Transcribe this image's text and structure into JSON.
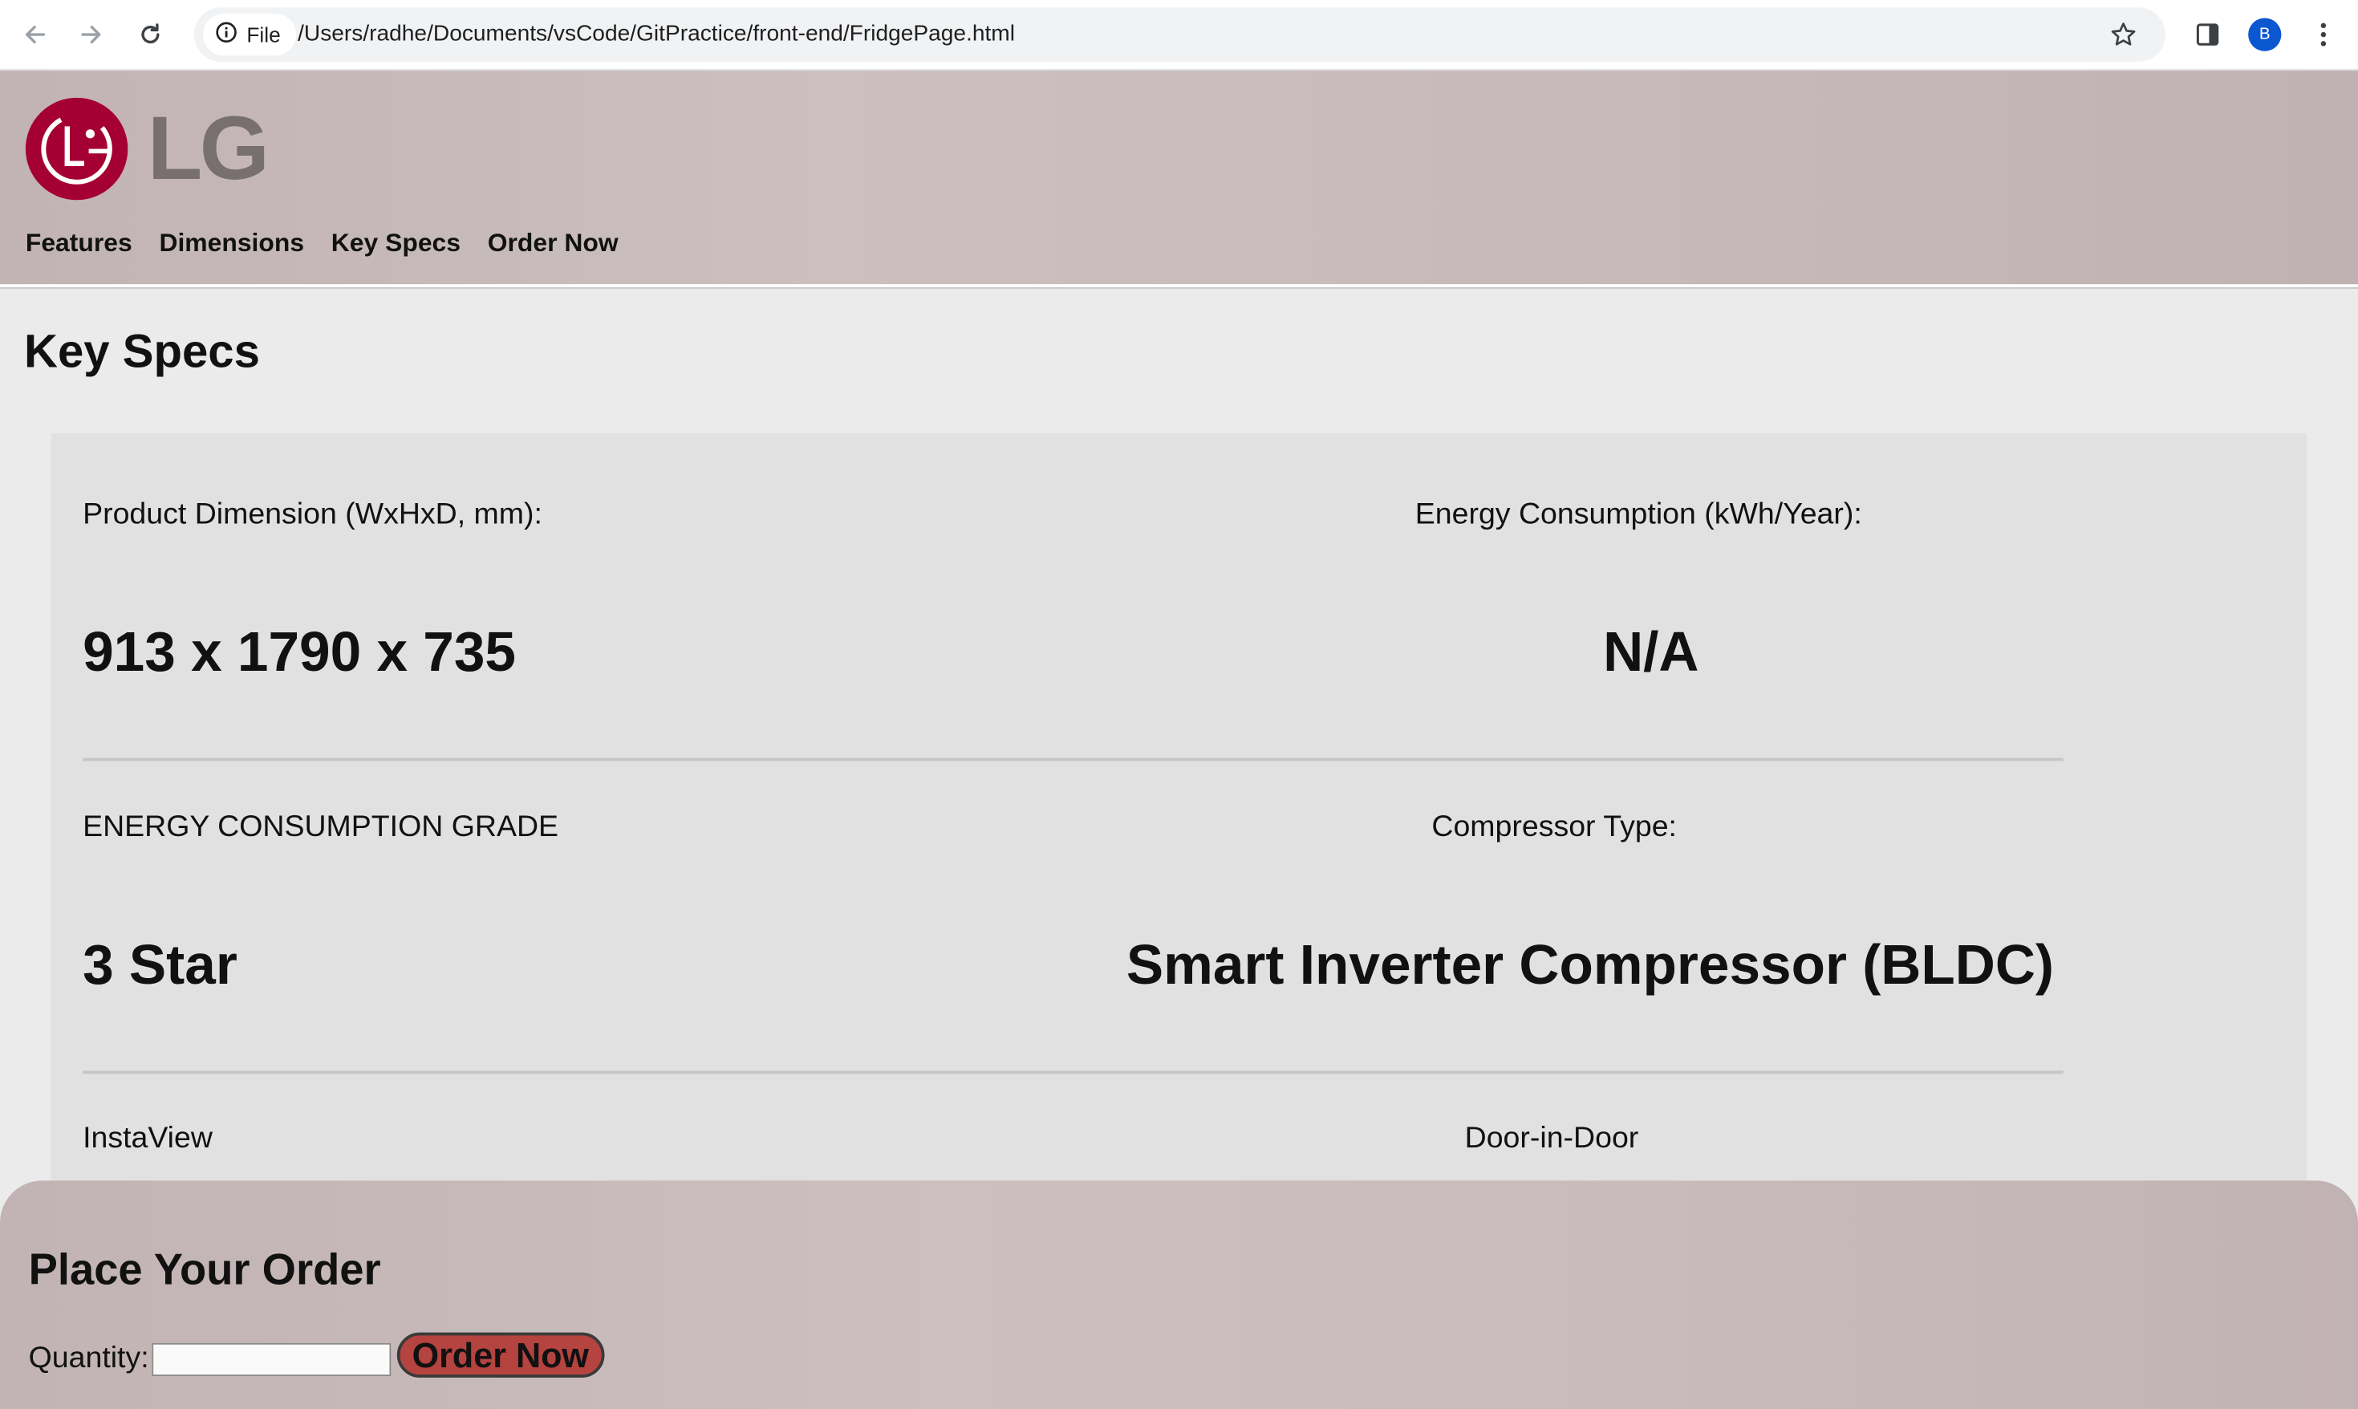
{
  "browser": {
    "file_chip_label": "File",
    "url": "/Users/radhe/Documents/vsCode/GitPractice/front-end/FridgePage.html",
    "profile_initial": "B"
  },
  "header": {
    "logo_text": "LG",
    "nav": [
      {
        "label": "Features"
      },
      {
        "label": "Dimensions"
      },
      {
        "label": "Key Specs"
      },
      {
        "label": "Order Now"
      }
    ]
  },
  "key_specs": {
    "title": "Key Specs",
    "rows": [
      {
        "left": {
          "label": "Product Dimension (WxHxD, mm):",
          "value": "913 x 1790 x 735"
        },
        "right": {
          "label": "Energy Consumption (kWh/Year):",
          "value": "N/A"
        }
      },
      {
        "left": {
          "label": "ENERGY CONSUMPTION GRADE",
          "value": "3 Star"
        },
        "right": {
          "label": "Compressor Type:",
          "value": "Smart Inverter Compressor (BLDC)"
        }
      },
      {
        "left": {
          "label": "InstaView"
        },
        "right": {
          "label": "Door-in-Door"
        }
      }
    ]
  },
  "order": {
    "title": "Place Your Order",
    "quantity_label": "Quantity:",
    "quantity_value": "",
    "button_label": "Order Now"
  },
  "colors": {
    "header_bg": "#c7b9b9",
    "page_bg": "#ebebeb",
    "panel_bg": "#e1e1e1",
    "lg_red": "#a50034",
    "lg_gray": "#77706f",
    "order_button": "#b5433f"
  },
  "icons": {
    "back": "back-arrow-icon",
    "forward": "forward-arrow-icon",
    "reload": "reload-icon",
    "info": "info-icon",
    "bookmark": "star-icon",
    "side_panel": "side-panel-icon",
    "menu": "kebab-menu-icon"
  }
}
